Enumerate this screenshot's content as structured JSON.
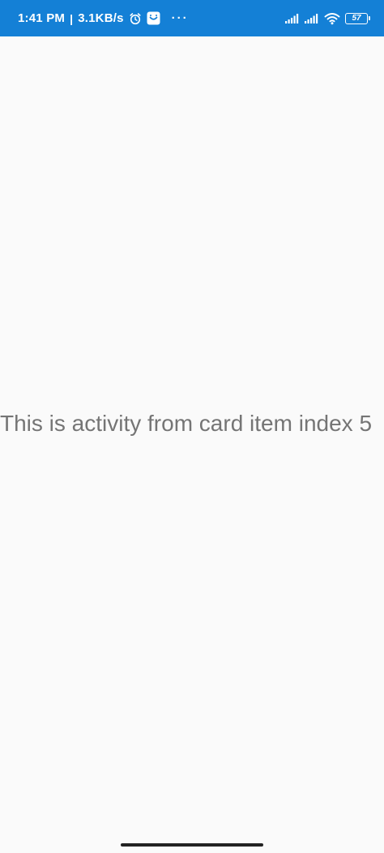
{
  "status_bar": {
    "time": "1:41 PM",
    "separator": "|",
    "network_speed": "3.1KB/s",
    "icons": [
      "alarm-icon",
      "app-notification-icon",
      "more-dots-icon",
      "signal-icon",
      "signal-icon",
      "wifi-icon",
      "battery-icon"
    ],
    "more": "···",
    "battery_level": "57",
    "background_color": "#1480d6"
  },
  "main": {
    "message": "This is activity from card item index 5"
  },
  "colors": {
    "background": "#fafafa",
    "text": "#757575"
  }
}
